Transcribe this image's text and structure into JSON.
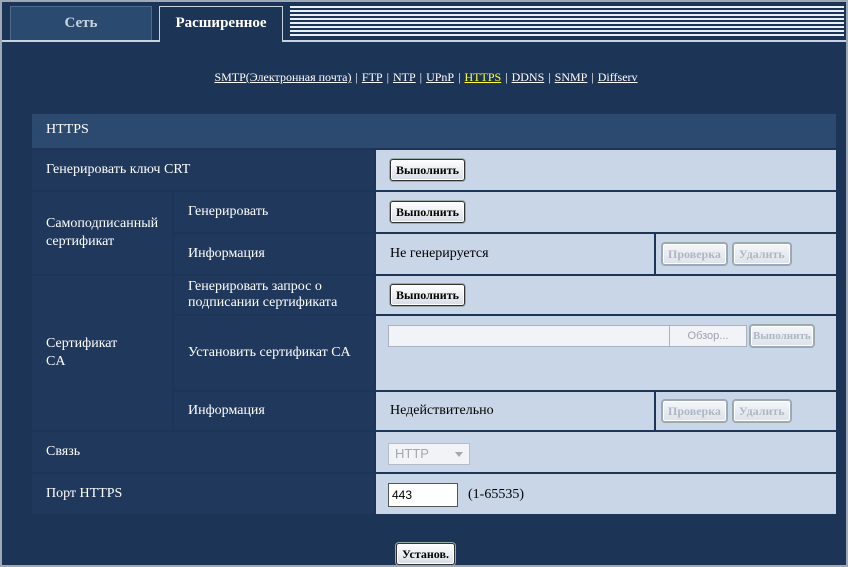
{
  "tabs": {
    "network": "Сеть",
    "advanced": "Расширенное"
  },
  "links": [
    "SMTP(Электронная почта)",
    "FTP",
    "NTP",
    "UPnP",
    "HTTPS",
    "DDNS",
    "SNMP",
    "Diffserv"
  ],
  "active_link": "HTTPS",
  "panel_title": "HTTPS",
  "rows": {
    "gen_crt": {
      "label": "Генерировать ключ CRT",
      "button": "Выполнить"
    },
    "self_signed": {
      "label": "Самоподписанный сертификат",
      "generate": {
        "label": "Генерировать",
        "button": "Выполнить"
      },
      "info": {
        "label": "Информация",
        "value": "Не генерируется",
        "check": "Проверка",
        "delete": "Удалить"
      }
    },
    "ca": {
      "label": "Сертификат CA",
      "csr": {
        "label": "Генерировать запрос о подписании сертификата",
        "button": "Выполнить"
      },
      "install": {
        "label": "Установить сертификат CA",
        "browse": "Обзор...",
        "button": "Выполнить"
      },
      "info": {
        "label": "Информация",
        "value": "Недействительно",
        "check": "Проверка",
        "delete": "Удалить"
      }
    },
    "connection": {
      "label": "Связь",
      "value": "HTTP"
    },
    "port": {
      "label": "Порт HTTPS",
      "value": "443",
      "range": "(1-65535)"
    }
  },
  "set_button": "Установ.",
  "colors": {
    "background": "#1c3556",
    "label_cell": "#20385c",
    "value_cell": "#c9d6e8",
    "active_link": "#ffff33"
  }
}
